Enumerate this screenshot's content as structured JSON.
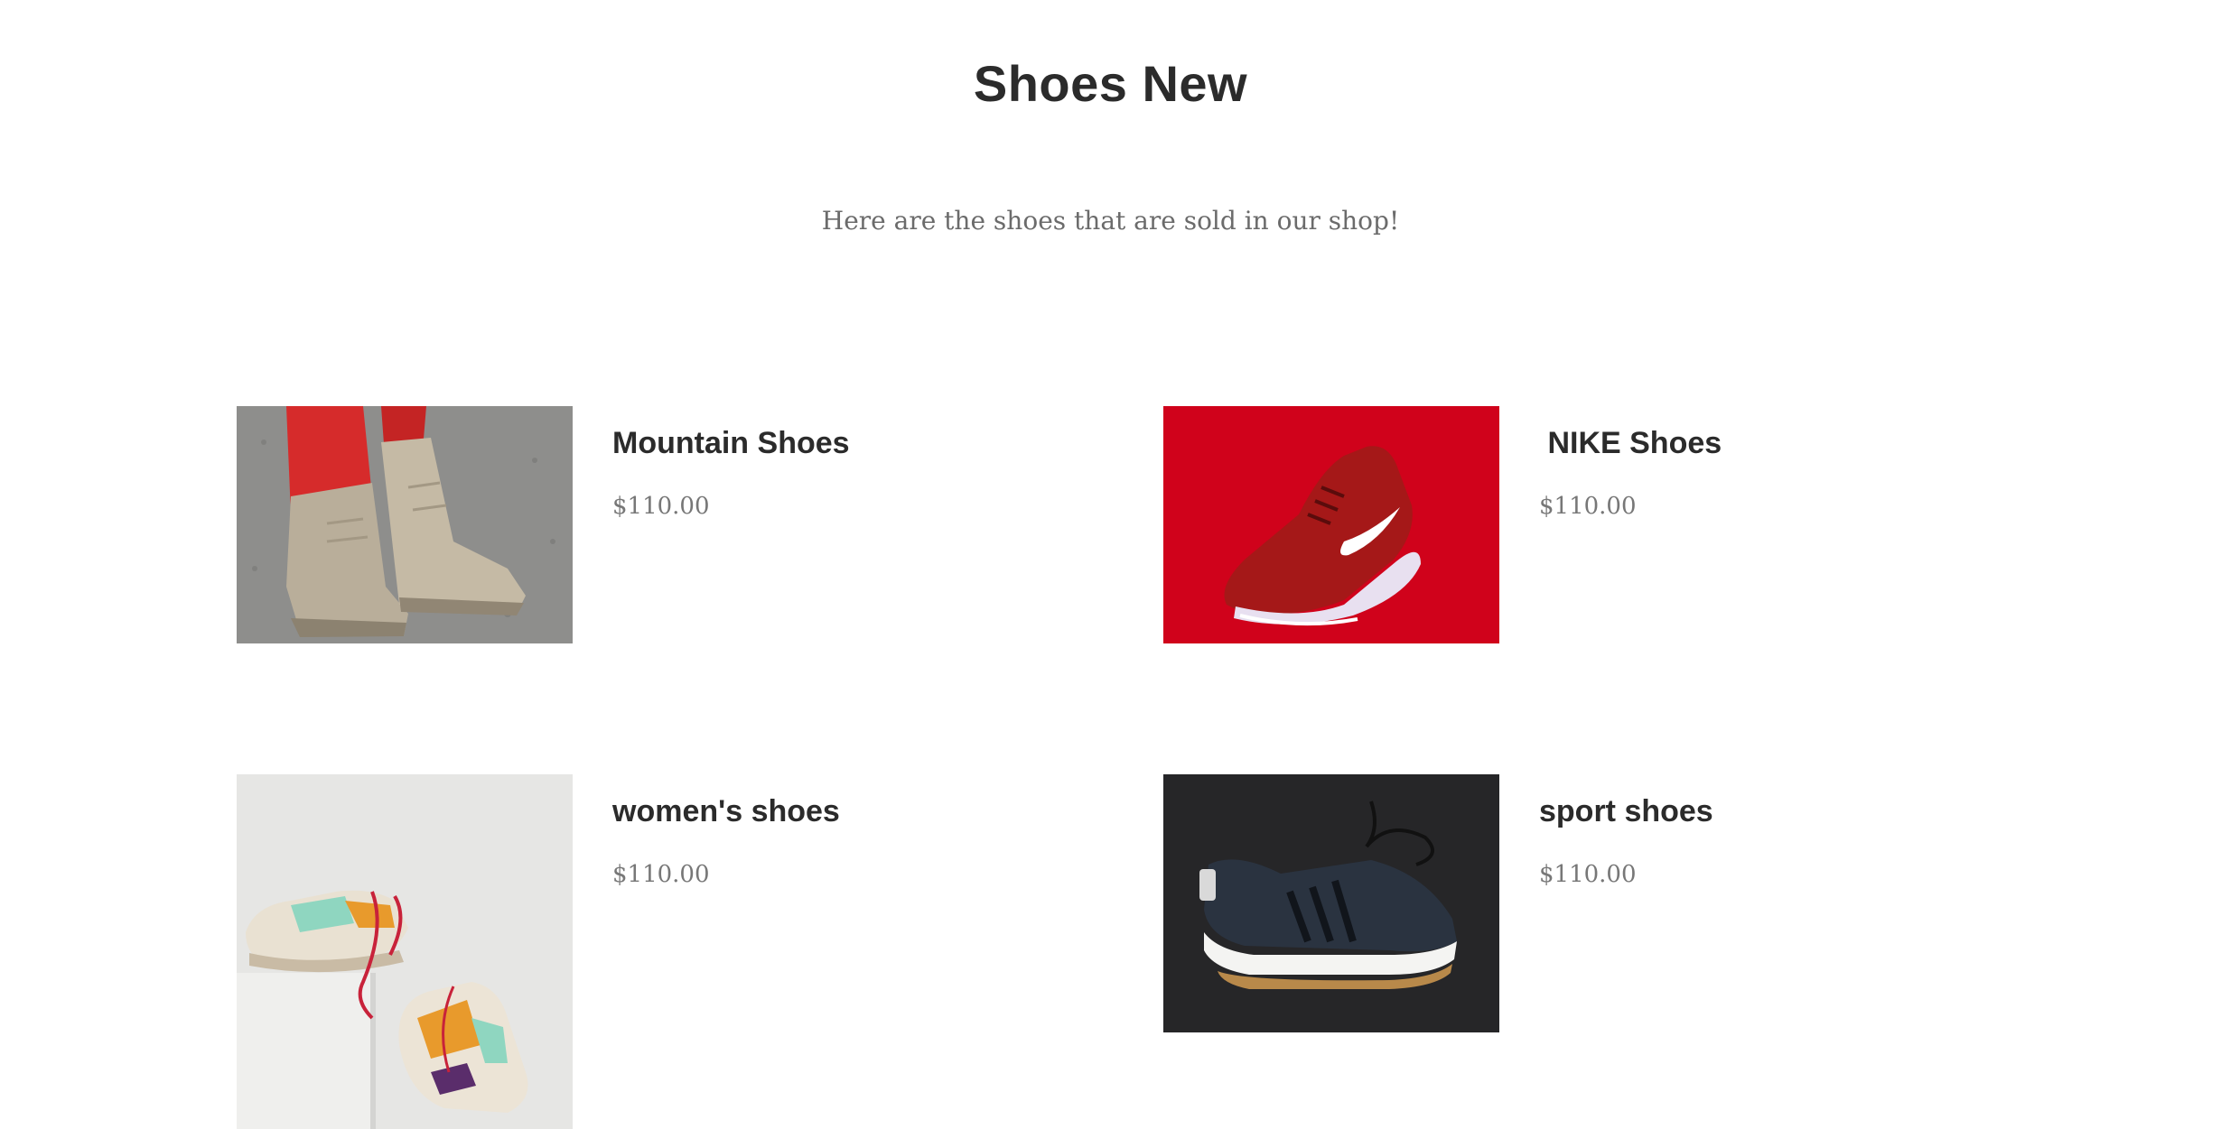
{
  "header": {
    "title": "Shoes New",
    "subtitle": "Here are the shoes that are sold in our shop!"
  },
  "products": [
    {
      "name": "Mountain Shoes",
      "price": "$110.00",
      "image_icon": "tan-boots-photo"
    },
    {
      "name": " NIKE Shoes",
      "price": "$110.00",
      "image_icon": "red-sneaker-photo"
    },
    {
      "name": "women's shoes",
      "price": "$110.00",
      "image_icon": "colorful-sneakers-photo"
    },
    {
      "name": "sport shoes",
      "price": "$110.00",
      "image_icon": "black-sneaker-photo"
    }
  ],
  "colors": {
    "title": "#2b2b2b",
    "subtitle": "#6b6b6b",
    "price": "#777777",
    "nike_background": "#d0021b"
  }
}
